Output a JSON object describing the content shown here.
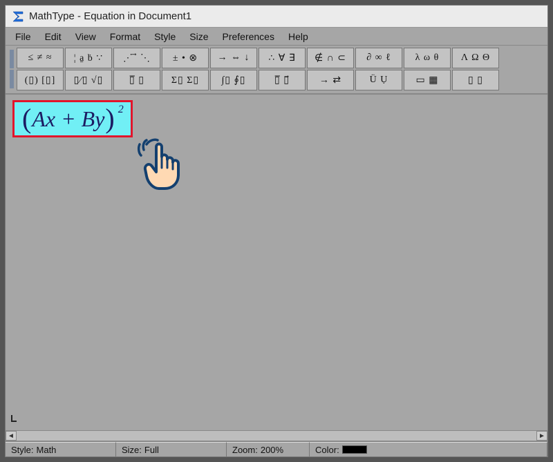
{
  "window": {
    "title": "MathType - Equation in Document1"
  },
  "menu": {
    "items": [
      "File",
      "Edit",
      "View",
      "Format",
      "Style",
      "Size",
      "Preferences",
      "Help"
    ]
  },
  "toolbar": {
    "row1": [
      "≤ ≠ ≈",
      "¦ a̱ ḃ ∵",
      "⋰ ⃗ ⋱",
      "± • ⊗",
      "→ ⇔ ↓",
      "∴ ∀ ∃",
      "∉ ∩ ⊂",
      "∂ ∞ ℓ",
      "λ ω θ",
      "Λ Ω Θ"
    ],
    "row2": [
      "(▯) [▯]",
      "▯⁄▯ √▯",
      "▯̅ ▯",
      "Σ▯ Σ▯",
      "∫▯ ∮▯",
      "▯̅ ▯⃗",
      "→ ⇄",
      "Ü  Ụ",
      "▭ ▦",
      "▯ ▯"
    ]
  },
  "equation": {
    "open": "(",
    "body": "Ax + By",
    "close": ")",
    "superscript": "2"
  },
  "status": {
    "style_label": "Style:",
    "style_value": "Math",
    "size_label": "Size:",
    "size_value": "Full",
    "zoom_label": "Zoom:",
    "zoom_value": "200%",
    "color_label": "Color:",
    "color_value": "#000000"
  },
  "scrollbar": {
    "left": "◄",
    "right": "►"
  }
}
